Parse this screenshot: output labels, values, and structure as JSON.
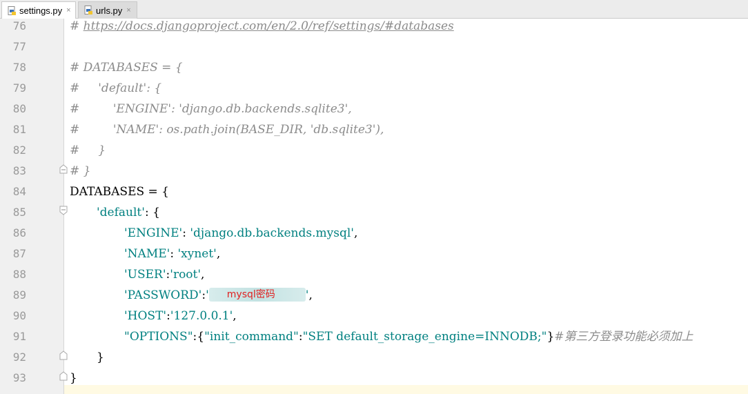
{
  "tabs": [
    {
      "label": "settings.py",
      "icon": "python-file-icon",
      "active": true
    },
    {
      "label": "urls.py",
      "icon": "python-file-icon",
      "active": false
    }
  ],
  "close_glyph": "×",
  "lines": [
    {
      "num": "76"
    },
    {
      "num": "77"
    },
    {
      "num": "78"
    },
    {
      "num": "79"
    },
    {
      "num": "80"
    },
    {
      "num": "81"
    },
    {
      "num": "82"
    },
    {
      "num": "83"
    },
    {
      "num": "84"
    },
    {
      "num": "85"
    },
    {
      "num": "86"
    },
    {
      "num": "87"
    },
    {
      "num": "88"
    },
    {
      "num": "89"
    },
    {
      "num": "90"
    },
    {
      "num": "91"
    },
    {
      "num": "92"
    },
    {
      "num": "93"
    }
  ],
  "code": {
    "l76_hash": "# ",
    "l76_url": "https://docs.djangoproject.com/en/2.0/ref/settings/#databases",
    "l78": "# DATABASES = {",
    "l79": "#     'default': {",
    "l80": "#         'ENGINE': 'django.db.backends.sqlite3',",
    "l81": "#         'NAME': os.path.join(BASE_DIR, 'db.sqlite3'),",
    "l82": "#     }",
    "l83": "# }",
    "l84": "DATABASES = {",
    "l85_key": "'default'",
    "l85_rest": ": {",
    "l86_key": "'ENGINE'",
    "l86_sep": ": ",
    "l86_val": "'django.db.backends.mysql'",
    "l86_end": ",",
    "l87_key": "'NAME'",
    "l87_sep": ": ",
    "l87_val": "'xynet'",
    "l87_end": ",",
    "l88_key": "'USER'",
    "l88_sep": ":",
    "l88_val": "'root'",
    "l88_end": ",",
    "l89_key": "'PASSWORD'",
    "l89_sep": ":",
    "l89_open": "'",
    "l89_redacted_label": "mysql密码",
    "l89_close": "'",
    "l89_end": ",",
    "l90_key": "'HOST'",
    "l90_sep": ":",
    "l90_val": "'127.0.0.1'",
    "l90_end": ",",
    "l91_key": "\"OPTIONS\"",
    "l91_sep": ":",
    "l91_brace_open": "{",
    "l91_inner_key": "\"init_command\"",
    "l91_inner_sep": ":",
    "l91_inner_val": "\"SET default_storage_engine=INNODB;\"",
    "l91_brace_close": "}",
    "l91_comment": "#第三方登录功能必须加上",
    "l92": "}",
    "l93": "}"
  },
  "colors": {
    "comment": "#8c8c8c",
    "string": "#008080",
    "redaction_label": "#e02020",
    "gutter_bg": "#f0f0f0",
    "current_line": "#fffae3"
  }
}
